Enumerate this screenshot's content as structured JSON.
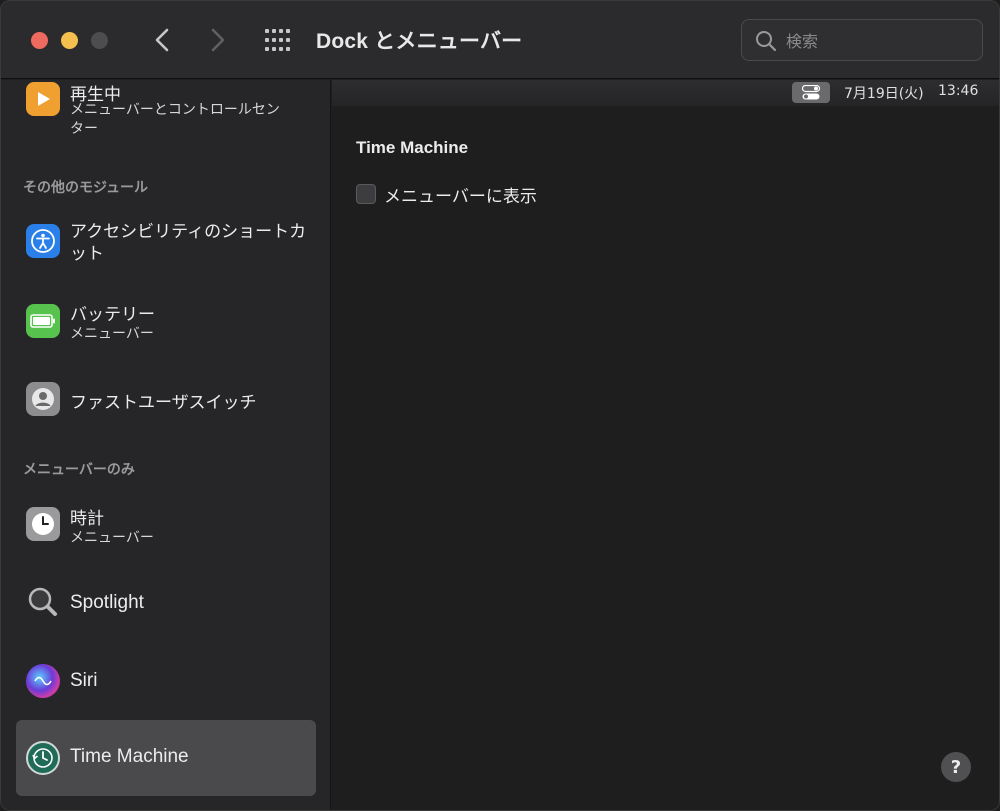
{
  "window": {
    "title": "Dock とメニューバー",
    "search_placeholder": "検索"
  },
  "sidebar": {
    "top_items": [
      {
        "name": "再生中",
        "sub": "メニューバーとコントロールセンター",
        "icon": "play-icon"
      }
    ],
    "section_other": "その他のモジュール",
    "other_items": [
      {
        "name": "アクセシビリティのショートカット",
        "icon": "accessibility-icon"
      },
      {
        "name": "バッテリー",
        "sub": "メニューバー",
        "icon": "battery-icon"
      },
      {
        "name": "ファストユーザスイッチ",
        "icon": "user-switch-icon"
      }
    ],
    "section_menubar_only": "メニューバーのみ",
    "menubar_items": [
      {
        "name": "時計",
        "sub": "メニューバー",
        "icon": "clock-icon"
      },
      {
        "name": "Spotlight",
        "icon": "spotlight-icon"
      },
      {
        "name": "Siri",
        "icon": "siri-icon"
      },
      {
        "name": "Time Machine",
        "icon": "time-machine-icon",
        "selected": true
      }
    ]
  },
  "menubar_preview": {
    "date": "7月19日(火)",
    "time": "13:46"
  },
  "content": {
    "section_title": "Time Machine",
    "show_in_menubar_label": "メニューバーに表示",
    "show_in_menubar_checked": false
  },
  "help_label": "?",
  "colors": {
    "accent_red": "#ed6a5e",
    "accent_yellow": "#f5bf4f",
    "selected_bg": "#4a4a4c"
  }
}
